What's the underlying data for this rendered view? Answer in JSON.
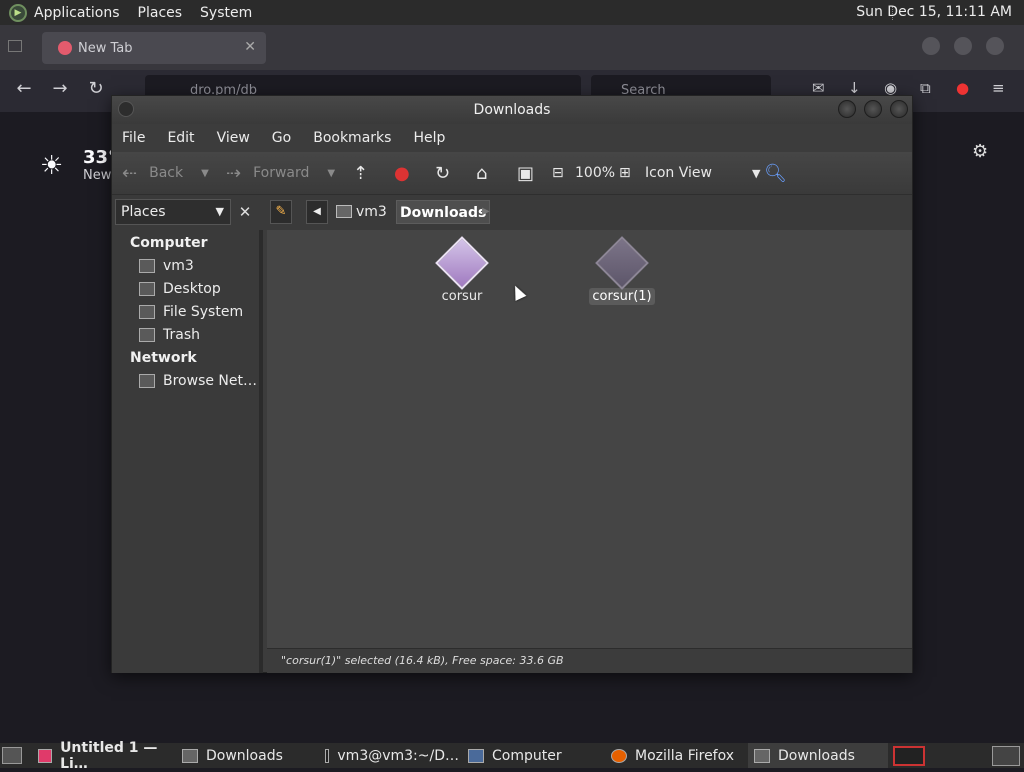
{
  "top_panel": {
    "menus": [
      "Applications",
      "Places",
      "System"
    ],
    "clock": "Sun Dec 15, 11:11 AM"
  },
  "firefox": {
    "tab_title": "New Tab",
    "url_text": "dro.pm/db",
    "search_placeholder": "Search",
    "weather_temp": "33°",
    "weather_loc": "New"
  },
  "caja": {
    "title": "Downloads",
    "menus": [
      "File",
      "Edit",
      "View",
      "Go",
      "Bookmarks",
      "Help"
    ],
    "toolbar": {
      "back": "Back",
      "forward": "Forward",
      "zoom": "100%",
      "view_mode": "Icon View"
    },
    "places_label": "Places",
    "breadcrumbs": [
      "vm3",
      "Downloads"
    ],
    "sidebar": {
      "computer_header": "Computer",
      "computer_items": [
        "vm3",
        "Desktop",
        "File System",
        "Trash"
      ],
      "network_header": "Network",
      "network_items": [
        "Browse Net…"
      ]
    },
    "files": [
      {
        "name": "corsur",
        "selected": false
      },
      {
        "name": "corsur(1)",
        "selected": true
      }
    ],
    "status": "\"corsur(1)\" selected (16.4 kB), Free space: 33.6 GB"
  },
  "taskbar": {
    "tasks": [
      {
        "label": "Untitled 1 — Li…",
        "icon": "libreoffice-icon"
      },
      {
        "label": "Downloads",
        "icon": "folder-icon"
      },
      {
        "label": "vm3@vm3:~/D…",
        "icon": "terminal-icon"
      },
      {
        "label": "Computer",
        "icon": "computer-icon"
      },
      {
        "label": "Mozilla Firefox",
        "icon": "firefox-icon"
      },
      {
        "label": "Downloads",
        "icon": "folder-icon"
      }
    ]
  }
}
